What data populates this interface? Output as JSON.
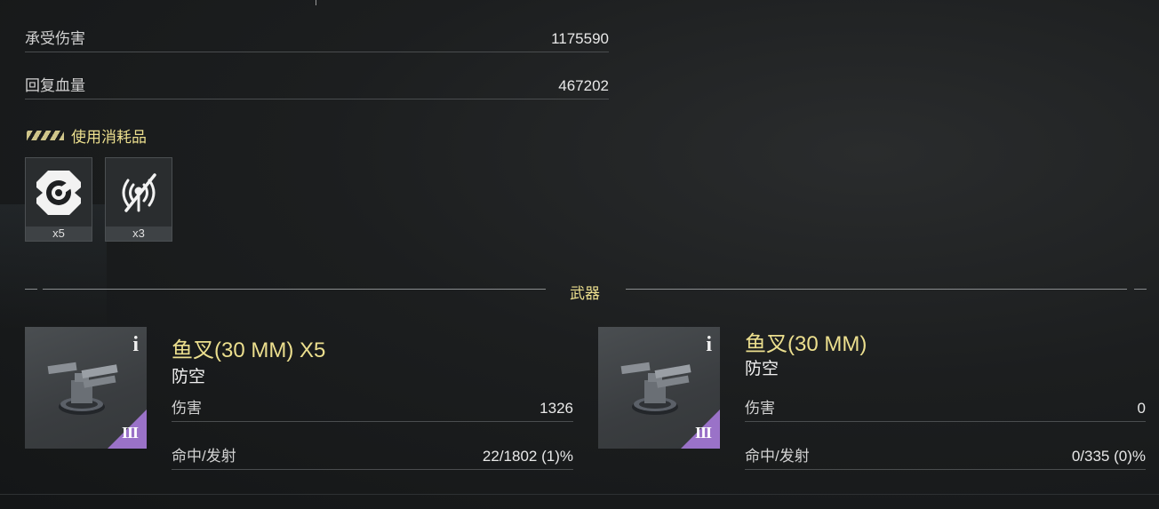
{
  "stats": [
    {
      "label": "承受伤害",
      "value": "1175590"
    },
    {
      "label": "回复血量",
      "value": "467202"
    }
  ],
  "consumables_section": {
    "title": "使用消耗品",
    "items": [
      {
        "icon": "repair-wrench-icon",
        "count": "x5"
      },
      {
        "icon": "signal-jammer-icon",
        "count": "x3"
      }
    ]
  },
  "weapons_section": {
    "title": "武器",
    "weapons": [
      {
        "name": "鱼叉(30 MM) X5",
        "type": "防空",
        "tier": "III",
        "info_icon": "i",
        "damage_label": "伤害",
        "damage": "1326",
        "hit_label": "命中/发射",
        "hit": "22/1802 (1)%"
      },
      {
        "name": "鱼叉(30 MM)",
        "type": "防空",
        "tier": "III",
        "info_icon": "i",
        "damage_label": "伤害",
        "damage": "0",
        "hit_label": "命中/发射",
        "hit": "0/335 (0)%"
      }
    ]
  },
  "colors": {
    "accent": "#ecdf8e",
    "tier": "#9a72c8"
  }
}
